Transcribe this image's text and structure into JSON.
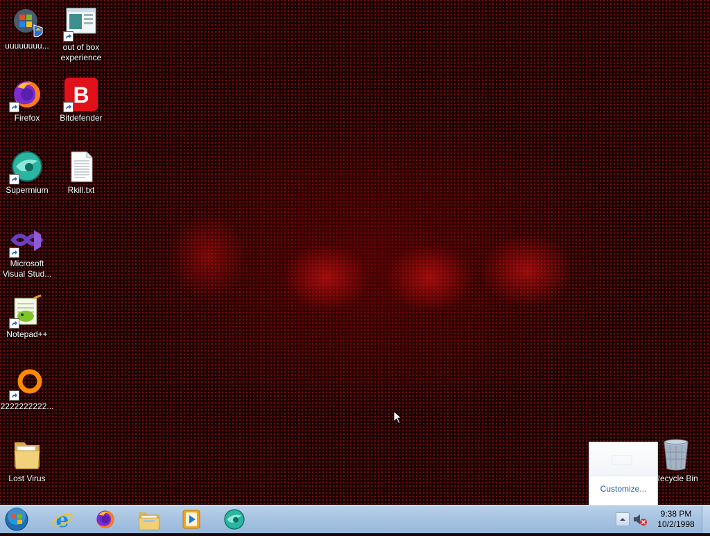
{
  "desktop": {
    "icons": [
      {
        "label": "uuuuuuuu...",
        "icon": "windows-update-icon"
      },
      {
        "label": "out of box experience",
        "icon": "oobe-window-icon"
      },
      {
        "label": "Firefox",
        "icon": "firefox-icon"
      },
      {
        "label": "Bitdefender",
        "icon": "bitdefender-icon"
      },
      {
        "label": "Supermium",
        "icon": "supermium-icon"
      },
      {
        "label": "Rkill.txt",
        "icon": "text-file-icon"
      },
      {
        "label": "Microsoft Visual Stud...",
        "icon": "visual-studio-icon"
      },
      {
        "label": "Notepad++",
        "icon": "notepad-plus-plus-icon"
      },
      {
        "label": "2222222222...",
        "icon": "orange-ring-icon"
      },
      {
        "label": "Lost Virus",
        "icon": "folder-icon"
      },
      {
        "label": "Recycle Bin",
        "icon": "recycle-bin-icon"
      }
    ]
  },
  "overflow_popup": {
    "customize_label": "Customize..."
  },
  "taskbar": {
    "start_icon": "windows-start-orb-icon",
    "pinned": [
      {
        "name": "Internet Explorer",
        "icon": "internet-explorer-icon"
      },
      {
        "name": "Firefox",
        "icon": "firefox-icon"
      },
      {
        "name": "Windows Explorer",
        "icon": "file-explorer-icon"
      },
      {
        "name": "Windows Media Player",
        "icon": "media-player-icon"
      },
      {
        "name": "Supermium",
        "icon": "supermium-icon"
      }
    ],
    "tray": {
      "show_hidden_icon": "chevron-up-icon",
      "volume_icon": "volume-muted-icon",
      "time": "9:38 PM",
      "date": "10/2/1998"
    }
  },
  "colors": {
    "wallpaper_base": "#1c0303",
    "wallpaper_dots": "#e01414",
    "taskbar": "#a8c4e2",
    "link_blue": "#1e5ba8"
  }
}
